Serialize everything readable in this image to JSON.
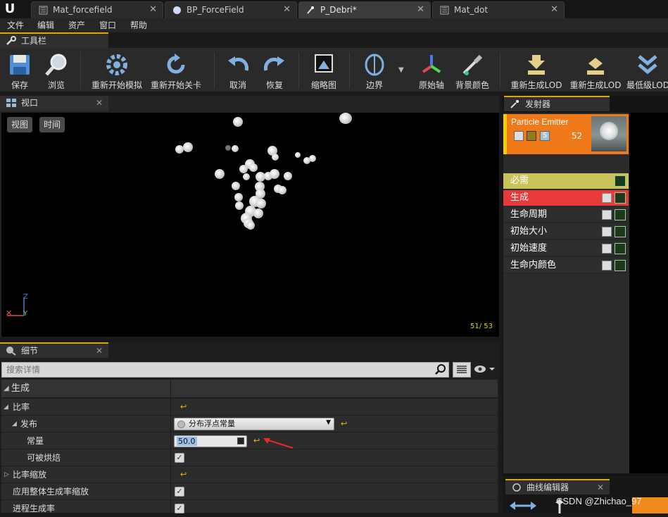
{
  "tabs": [
    {
      "label": "Mat_forcefield",
      "icon": "material-icon"
    },
    {
      "label": "BP_ForceField",
      "icon": "blueprint-icon"
    },
    {
      "label": "P_Debri*",
      "icon": "particle-icon",
      "active": true
    },
    {
      "label": "Mat_dot",
      "icon": "material-icon"
    }
  ],
  "menu": [
    "文件",
    "编辑",
    "资产",
    "窗口",
    "帮助"
  ],
  "toolbar": {
    "title": "工具栏",
    "buttons": [
      {
        "label": "保存",
        "icon": "save-icon"
      },
      {
        "label": "浏览",
        "icon": "browse-icon"
      },
      {
        "label": "重新开始模拟",
        "icon": "restart-sim-icon"
      },
      {
        "label": "重新开始关卡",
        "icon": "restart-level-icon"
      },
      {
        "label": "取消",
        "icon": "undo-icon"
      },
      {
        "label": "恢复",
        "icon": "redo-icon"
      },
      {
        "label": "缩略图",
        "icon": "thumbnail-icon"
      },
      {
        "label": "边界",
        "icon": "bounds-icon"
      },
      {
        "label": "原始轴",
        "icon": "axis-icon"
      },
      {
        "label": "背景颜色",
        "icon": "color-picker-icon"
      },
      {
        "label": "重新生成LOD",
        "icon": "regen-lod-icon"
      },
      {
        "label": "重新生成LOD",
        "icon": "regen-lod-icon"
      },
      {
        "label": "最低级LOD",
        "icon": "lowest-lod-icon"
      }
    ]
  },
  "viewport": {
    "title": "视口",
    "btn_view": "视图",
    "btn_time": "时间",
    "particle_count": "51/ 53",
    "axis_z": "Z",
    "axis_y": "Y"
  },
  "details": {
    "title": "细节",
    "search_placeholder": "搜索详情",
    "section": "生成",
    "rows": [
      {
        "name": "比率"
      },
      {
        "name": "发布",
        "dropdown": "分布浮点常量"
      },
      {
        "name": "常量",
        "value": "50.0"
      },
      {
        "name": "可被烘焙"
      },
      {
        "name": "比率缩放"
      },
      {
        "name": "应用整体生成率缩放"
      },
      {
        "name": "进程生成率"
      }
    ]
  },
  "emitter": {
    "title": "发射器",
    "name": "Particle Emitter",
    "count": "52",
    "modules": [
      {
        "label": "必需",
        "color": "#c9c35a"
      },
      {
        "label": "生成",
        "color": "#e83a3a"
      },
      {
        "label": "生命周期",
        "color": "#2e2e2e"
      },
      {
        "label": "初始大小",
        "color": "#2e2e2e"
      },
      {
        "label": "初始速度",
        "color": "#2e2e2e"
      },
      {
        "label": "生命内颜色",
        "color": "#2e2e2e"
      }
    ]
  },
  "curve_editor": {
    "title": "曲线编辑器"
  },
  "watermark": "CSDN @Zhichao_97"
}
